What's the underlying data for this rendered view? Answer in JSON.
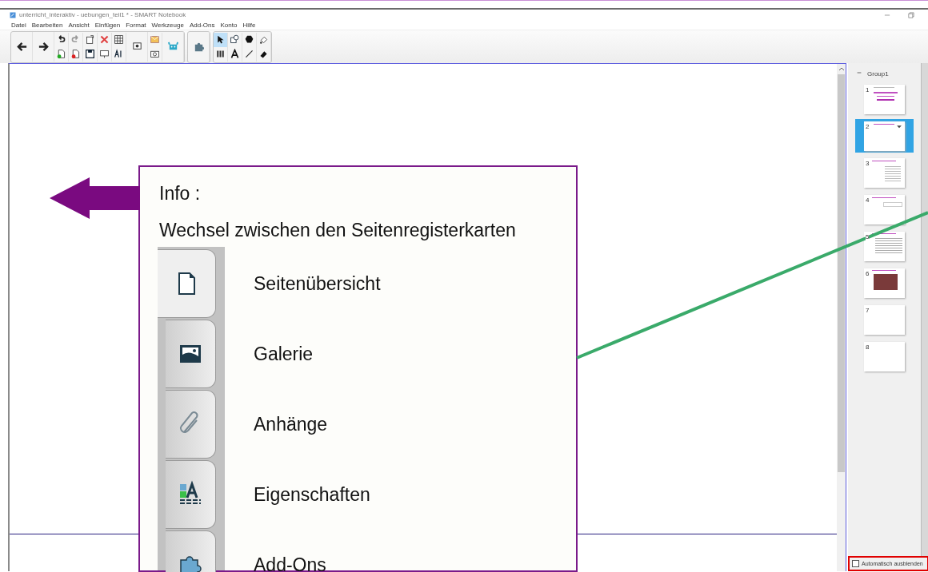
{
  "window": {
    "title": "unterricht_interaktiv - uebungen_teil1 * - SMART Notebook"
  },
  "menu": [
    "Datei",
    "Bearbeiten",
    "Ansicht",
    "Einfügen",
    "Format",
    "Werkzeuge",
    "Add-Ons",
    "Konto",
    "Hilfe"
  ],
  "tools": [
    {
      "kind": "select",
      "selected": true
    },
    {
      "kind": "shape",
      "selected": false
    },
    {
      "kind": "fill-shape",
      "selected": false
    },
    {
      "kind": "fill",
      "selected": false
    },
    {
      "kind": "pens",
      "selected": false
    },
    {
      "kind": "text",
      "selected": false
    },
    {
      "kind": "line",
      "selected": false
    },
    {
      "kind": "eraser",
      "selected": false
    }
  ],
  "page_sorter": {
    "group": "Group1",
    "expanded": true,
    "pages": [
      {
        "number": "1",
        "kind": "title",
        "selected": false
      },
      {
        "number": "2",
        "kind": "heading",
        "selected": true
      },
      {
        "number": "3",
        "kind": "text",
        "selected": false
      },
      {
        "number": "4",
        "kind": "box",
        "selected": false
      },
      {
        "number": "5",
        "kind": "dense",
        "selected": false
      },
      {
        "number": "6",
        "kind": "photo",
        "selected": false
      },
      {
        "number": "7",
        "kind": "blank",
        "selected": false
      },
      {
        "number": "8",
        "kind": "blank",
        "selected": false
      }
    ],
    "auto_hide": {
      "label": "Automatisch ausblenden",
      "checked": false
    }
  },
  "callout": {
    "title": "Info :",
    "subtitle": "Wechsel zwischen den Seitenregisterkarten",
    "tabs": [
      {
        "kind": "page",
        "label": "Seitenübersicht",
        "selected": true
      },
      {
        "kind": "gallery",
        "label": "Galerie",
        "selected": false
      },
      {
        "kind": "attachment",
        "label": "Anhänge",
        "selected": false
      },
      {
        "kind": "properties",
        "label": "Eigenschaften",
        "selected": false
      },
      {
        "kind": "addons",
        "label": "Add-Ons",
        "selected": false
      }
    ]
  }
}
